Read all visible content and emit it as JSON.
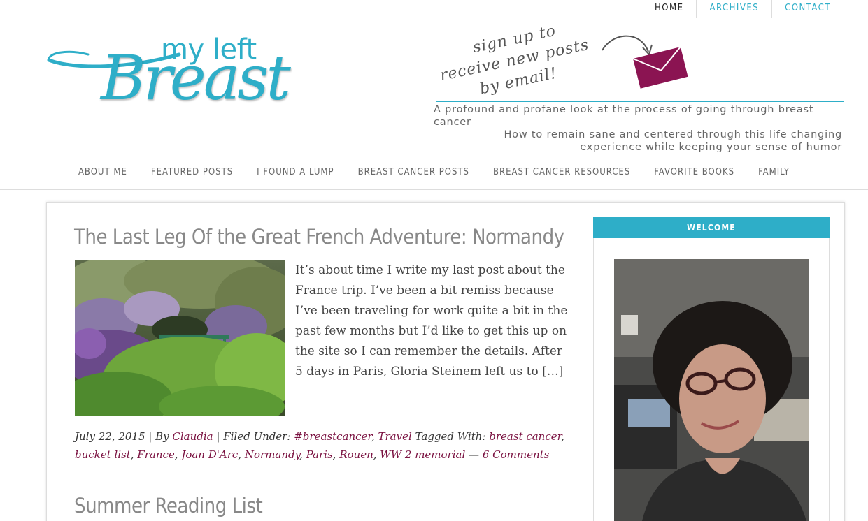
{
  "top_nav": {
    "items": [
      "HOME",
      "ARCHIVES",
      "CONTACT"
    ]
  },
  "logo": {
    "small_text": "my left",
    "big_text": "Breast"
  },
  "signup": {
    "line1": "sign up to",
    "line2": "receive new posts",
    "line3": "by email!",
    "icon": "envelope-icon"
  },
  "tagline": {
    "line1": "A profound and profane look at the process of going through breast cancer",
    "line2": "How to remain sane and centered through this life changing",
    "line3": "experience while keeping your sense of humor"
  },
  "main_nav": {
    "items": [
      "ABOUT ME",
      "FEATURED POSTS",
      "I FOUND A LUMP",
      "BREAST CANCER POSTS",
      "BREAST CANCER RESOURCES",
      "FAVORITE BOOKS",
      "FAMILY"
    ]
  },
  "post1": {
    "title": "The Last Leg Of the Great French Adventure: Normandy",
    "excerpt": "It’s about time I write my last post about the France trip. I’ve been a bit remiss because I’ve been traveling for work quite a bit in the past few months but I’d like to get this up on the site so I can remember the details. After 5 days in Paris, Gloria Steinem left us to […]",
    "date": "July 22, 2015",
    "by": " | By ",
    "author": "Claudia",
    "filed_under": " | Filed Under: ",
    "categories": [
      "#breastcancer",
      "Travel"
    ],
    "tagged_with": " Tagged With: ",
    "tags": [
      "breast cancer",
      "bucket list",
      "France",
      "Joan D'Arc",
      "Normandy",
      "Paris",
      "Rouen",
      "WW 2 memorial"
    ],
    "dash": " — ",
    "comments": "6 Comments"
  },
  "post2": {
    "title": "Summer Reading List"
  },
  "sidebar": {
    "widget_title": "WELCOME"
  },
  "colors": {
    "accent": "#2eaec8",
    "link": "#7a1140",
    "envelope": "#8b1452"
  }
}
